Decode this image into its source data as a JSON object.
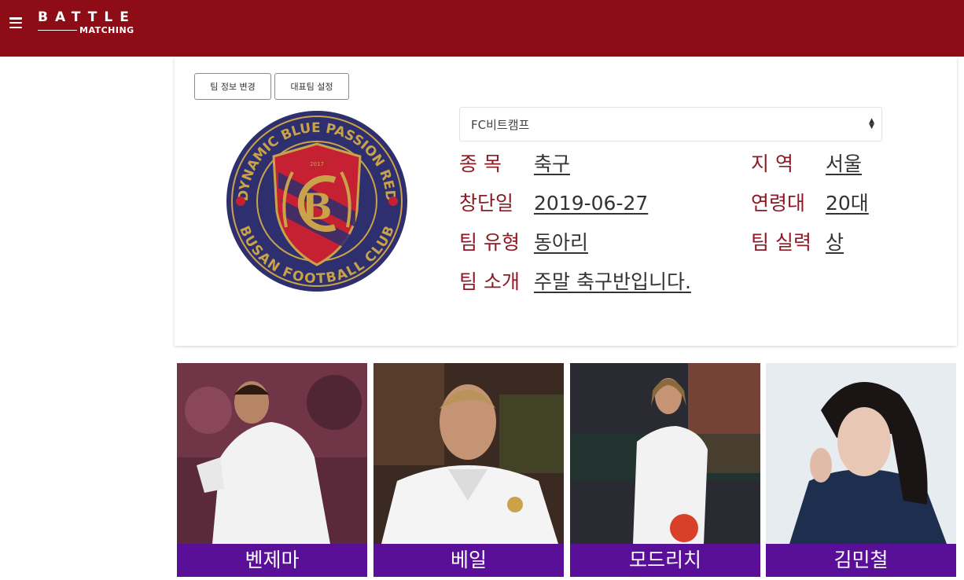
{
  "brand": {
    "name_line1": "BATTLE",
    "name_line2": "MATCHING",
    "bar_color": "#8d0c16"
  },
  "icons": {
    "menu": "hamburger-menu-icon",
    "select_caret": "updown-caret-icon"
  },
  "team_buttons": {
    "edit_label": "팀 정보 변경",
    "representative_label": "대표팀 설정"
  },
  "team_logo": {
    "ring_text_top": "DYNAMIC BLUE PASSION RED",
    "ring_text_bottom": "BUSAN FOOTBALL CLUB",
    "year": "2017"
  },
  "team_select": {
    "selected": "FC비트캠프"
  },
  "team_info": {
    "sport_label": "종 목",
    "sport_value": "축구",
    "region_label": "지 역",
    "region_value": "서울",
    "founded_label": "창단일",
    "founded_value": "2019-06-27",
    "age_label": "연령대",
    "age_value": "20대",
    "type_label": "팀 유형",
    "type_value": "동아리",
    "skill_label": "팀 실력",
    "skill_value": "상",
    "intro_label": "팀 소개",
    "intro_value": "주말 축구반입니다."
  },
  "players": [
    {
      "name": "벤제마"
    },
    {
      "name": "베일"
    },
    {
      "name": "모드리치"
    },
    {
      "name": "김민철"
    }
  ],
  "colors": {
    "label": "#8d1a24",
    "player_name_bg": "#5a0f99"
  }
}
